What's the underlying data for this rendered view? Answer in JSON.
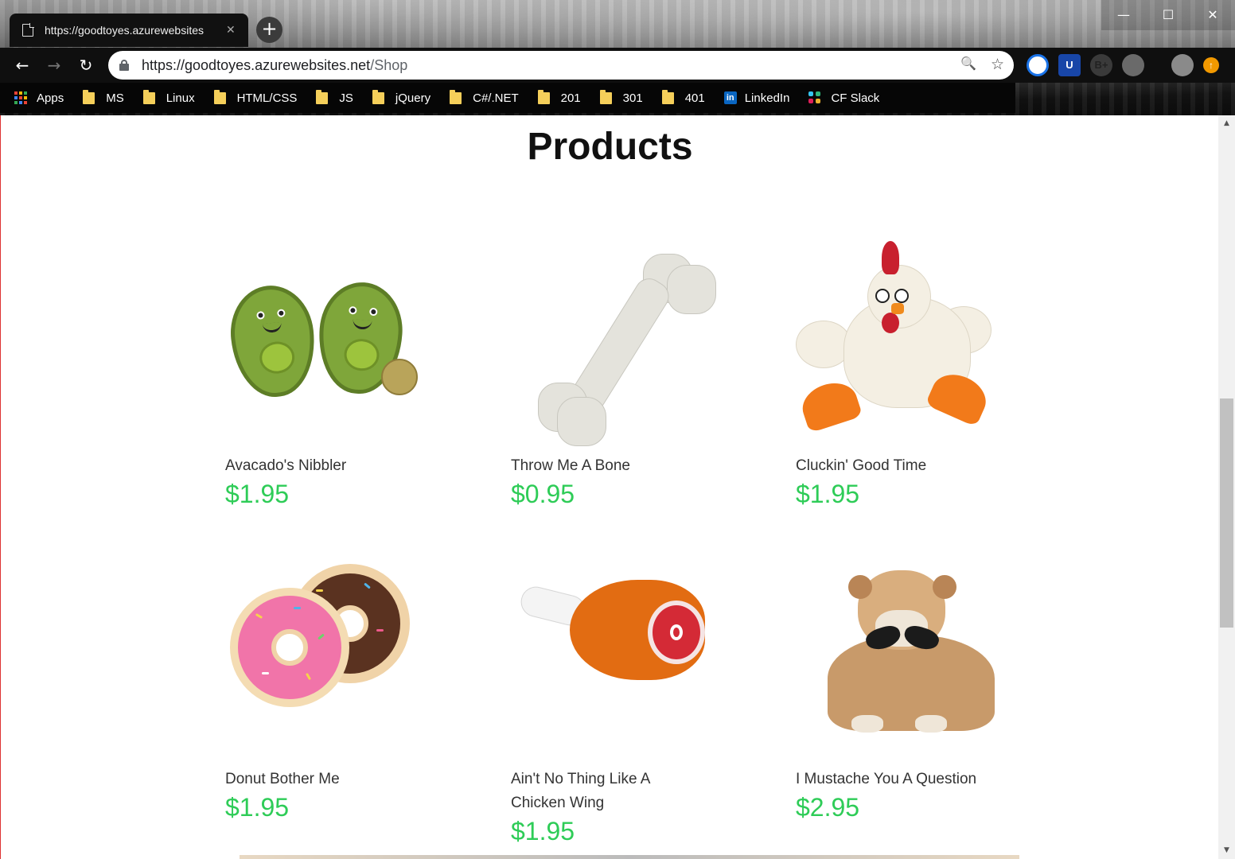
{
  "browser": {
    "tab": {
      "title": "https://goodtoyes.azurewebsites",
      "close_glyph": "✕",
      "new_tab_glyph": "+"
    },
    "window_controls": {
      "minimize": "—",
      "maximize": "☐",
      "close": "✕"
    },
    "nav": {
      "back": "←",
      "forward": "→",
      "reload": "↻"
    },
    "address": {
      "host": "https://goodtoyes.azurewebsites.net",
      "path": "/Shop"
    },
    "omnibox_icons": {
      "zoom": "🔍",
      "star": "☆"
    },
    "extensions": [
      {
        "icon": "magnifier-extension-icon",
        "label": "",
        "color": "#1a73e8"
      },
      {
        "icon": "ublock-extension-icon",
        "label": "U",
        "color": "#1846a8"
      },
      {
        "icon": "bplus-extension-icon",
        "label": "B+",
        "color": "#3a3a3a"
      },
      {
        "icon": "reddit-extension-icon",
        "label": "",
        "color": "#5a5a5a"
      },
      {
        "icon": "profile-avatar-icon",
        "label": "",
        "color": "#777777"
      },
      {
        "icon": "update-arrow-icon",
        "label": "↑",
        "color": "#f29900"
      }
    ],
    "bookmarks": [
      {
        "label": "Apps",
        "icon": "apps-grid-icon"
      },
      {
        "label": "MS",
        "icon": "folder-icon"
      },
      {
        "label": "Linux",
        "icon": "folder-icon"
      },
      {
        "label": "HTML/CSS",
        "icon": "folder-icon"
      },
      {
        "label": "JS",
        "icon": "folder-icon"
      },
      {
        "label": "jQuery",
        "icon": "folder-icon"
      },
      {
        "label": "C#/.NET",
        "icon": "folder-icon"
      },
      {
        "label": "201",
        "icon": "folder-icon"
      },
      {
        "label": "301",
        "icon": "folder-icon"
      },
      {
        "label": "401",
        "icon": "folder-icon"
      },
      {
        "label": "LinkedIn",
        "icon": "linkedin-icon"
      },
      {
        "label": "CF Slack",
        "icon": "slack-icon"
      }
    ]
  },
  "page": {
    "heading": "Products",
    "price_color": "#2ecc57",
    "products": [
      {
        "name": "Avacado's Nibbler",
        "price": "$1.95",
        "image": "avocado-toy-image"
      },
      {
        "name": "Throw Me A Bone",
        "price": "$0.95",
        "image": "bone-toy-image"
      },
      {
        "name": "Cluckin' Good Time",
        "price": "$1.95",
        "image": "chicken-toy-image"
      },
      {
        "name": "Donut Bother Me",
        "price": "$1.95",
        "image": "donut-toy-image"
      },
      {
        "name": "Ain't No Thing Like A Chicken Wing",
        "price": "$1.95",
        "image": "drumstick-toy-image"
      },
      {
        "name": "I Mustache You A Question",
        "price": "$2.95",
        "image": "bulldog-mustache-image"
      }
    ]
  },
  "scrollbar": {
    "up": "▲",
    "down": "▼"
  }
}
